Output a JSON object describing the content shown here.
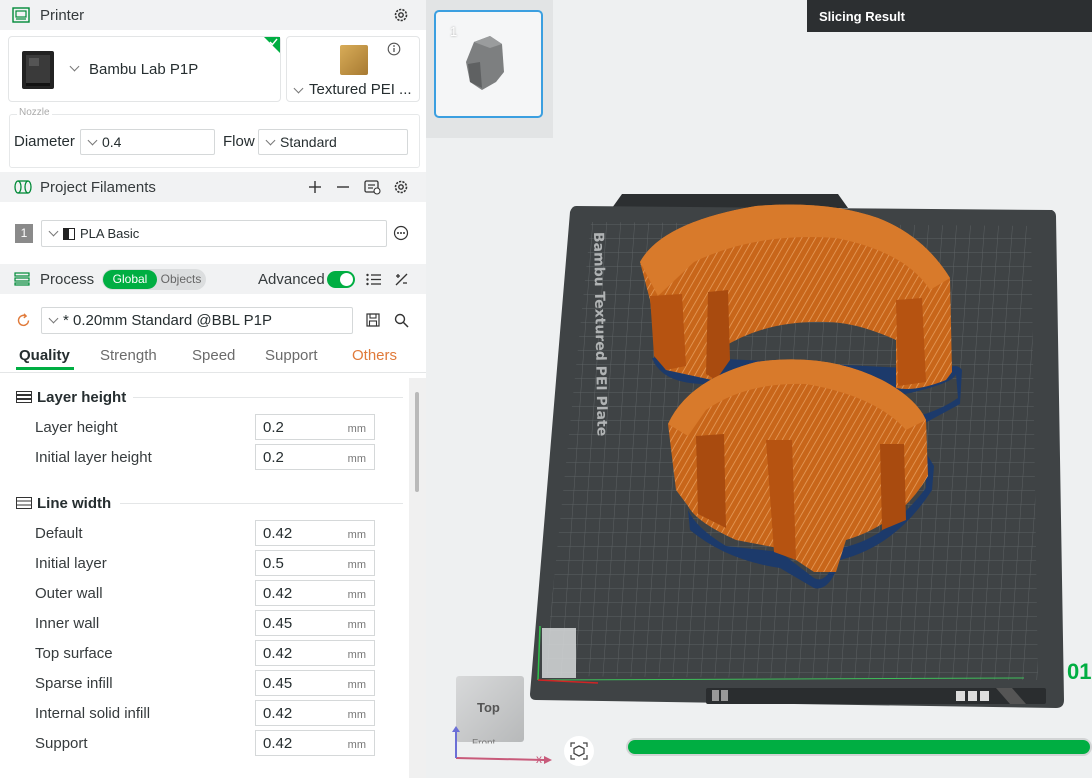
{
  "printer": {
    "title": "Printer",
    "model": "Bambu Lab P1P",
    "plate": "Textured PEI ...",
    "nozzle_legend": "Nozzle",
    "diameter_label": "Diameter",
    "diameter_value": "0.4",
    "flow_label": "Flow",
    "flow_value": "Standard"
  },
  "filaments": {
    "title": "Project Filaments",
    "items": [
      {
        "index": "1",
        "name": "PLA Basic"
      }
    ]
  },
  "process": {
    "title": "Process",
    "toggle_global": "Global",
    "toggle_objects": "Objects",
    "advanced_label": "Advanced",
    "advanced_on": true,
    "preset": "* 0.20mm Standard @BBL P1P",
    "tabs": [
      "Quality",
      "Strength",
      "Speed",
      "Support",
      "Others"
    ],
    "active_tab": "Quality"
  },
  "sections": [
    {
      "title": "Layer height",
      "rows": [
        {
          "label": "Layer height",
          "value": "0.2",
          "unit": "mm"
        },
        {
          "label": "Initial layer height",
          "value": "0.2",
          "unit": "mm"
        }
      ]
    },
    {
      "title": "Line width",
      "rows": [
        {
          "label": "Default",
          "value": "0.42",
          "unit": "mm"
        },
        {
          "label": "Initial layer",
          "value": "0.5",
          "unit": "mm"
        },
        {
          "label": "Outer wall",
          "value": "0.42",
          "unit": "mm"
        },
        {
          "label": "Inner wall",
          "value": "0.45",
          "unit": "mm"
        },
        {
          "label": "Top surface",
          "value": "0.42",
          "unit": "mm"
        },
        {
          "label": "Sparse infill",
          "value": "0.45",
          "unit": "mm"
        },
        {
          "label": "Internal solid infill",
          "value": "0.42",
          "unit": "mm"
        },
        {
          "label": "Support",
          "value": "0.42",
          "unit": "mm"
        }
      ]
    }
  ],
  "viewport": {
    "plate_thumb_number": "1",
    "plate_brand_text": "Bambu Textured PEI Plate",
    "slicing_result_label": "Slicing Result",
    "layer_number": "01",
    "nav_cube_face": "Top",
    "nav_cube_front": "Front",
    "axis_x_label": "x",
    "progress": 1.0
  },
  "colors": {
    "accent": "#00ae42",
    "orange_tab": "#e07a3a",
    "model": "#c4600f",
    "wall": "#1c3a6b",
    "plate": "#3f4345"
  }
}
